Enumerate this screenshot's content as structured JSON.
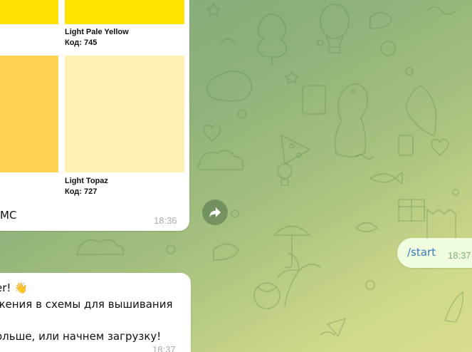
{
  "palette_message": {
    "swatches": [
      {
        "name": "Light Pale Yellow",
        "code": "Код: 745",
        "color": "#ffe500"
      },
      {
        "name": "Light Topaz",
        "code": "Код: 727",
        "color": "#fff0b3"
      }
    ],
    "left_colors": [
      "#ffe000",
      "#ffd34f"
    ],
    "caption": "МС",
    "time": "18:36"
  },
  "outgoing_message": {
    "text": "/start",
    "time": "18:37"
  },
  "greeting_message": {
    "lines": [
      "er! 👋",
      "жения в схемы для вышивания",
      "",
      "ольше, или начнем загрузку!"
    ],
    "time": "18:37"
  },
  "icons": {
    "forward": "forward-icon"
  },
  "colors": {
    "outgoing_bubble": "#effdde",
    "command_link": "#3a7bbf",
    "background_start": "#7fa877",
    "background_end": "#d8dc8c"
  }
}
